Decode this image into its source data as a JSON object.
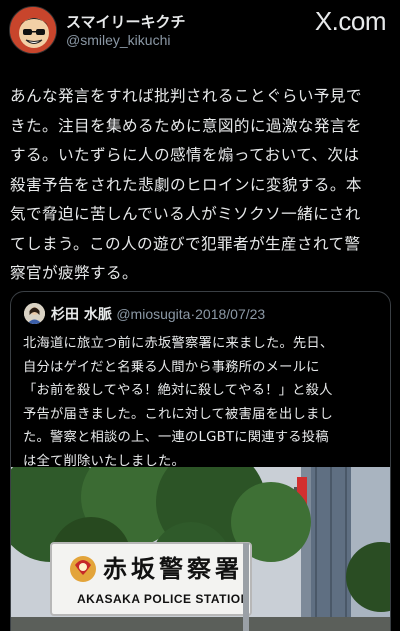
{
  "header": {
    "display_name": "スマイリーキクチ",
    "handle": "@smiley_kikuchi",
    "brand": "X.com"
  },
  "tweet": {
    "lines": [
      "あんな発言をすれば批判されることぐらい予見で",
      "きた。注目を集めるために意図的に過激な発言を",
      "する。いたずらに人の感情を煽っておいて、次は",
      "殺害予告をされた悲劇のヒロインに変貌する。本",
      "気で脅迫に苦しんでいる人がミソクソ一緒にされ",
      "てしまう。この人の遊びで犯罪者が生産されて警",
      "察官が疲弊する。"
    ]
  },
  "quote": {
    "name": "杉田 水脈",
    "handle": "@miosugita",
    "separator": "·",
    "date": "2018/07/23",
    "lines": [
      "北海道に旅立つ前に赤坂警察署に来ました。先日、",
      "自分はゲイだと名乗る人間から事務所のメールに",
      "「お前を殺してやる！絶対に殺してやる！」と殺人",
      "予告が届きました。これに対して被害届を出しまし",
      "た。警察と相談の上、一連のLGBTに関連する投稿",
      "は全て削除いたしました。"
    ],
    "photo": {
      "sign_kanji": "赤坂警察署",
      "sign_romaji": "AKASAKA POLICE STATION"
    }
  },
  "colors": {
    "background": "#000000",
    "text": "#e7e9ea",
    "secondary": "#8b98a5",
    "border": "#3a3f44"
  }
}
